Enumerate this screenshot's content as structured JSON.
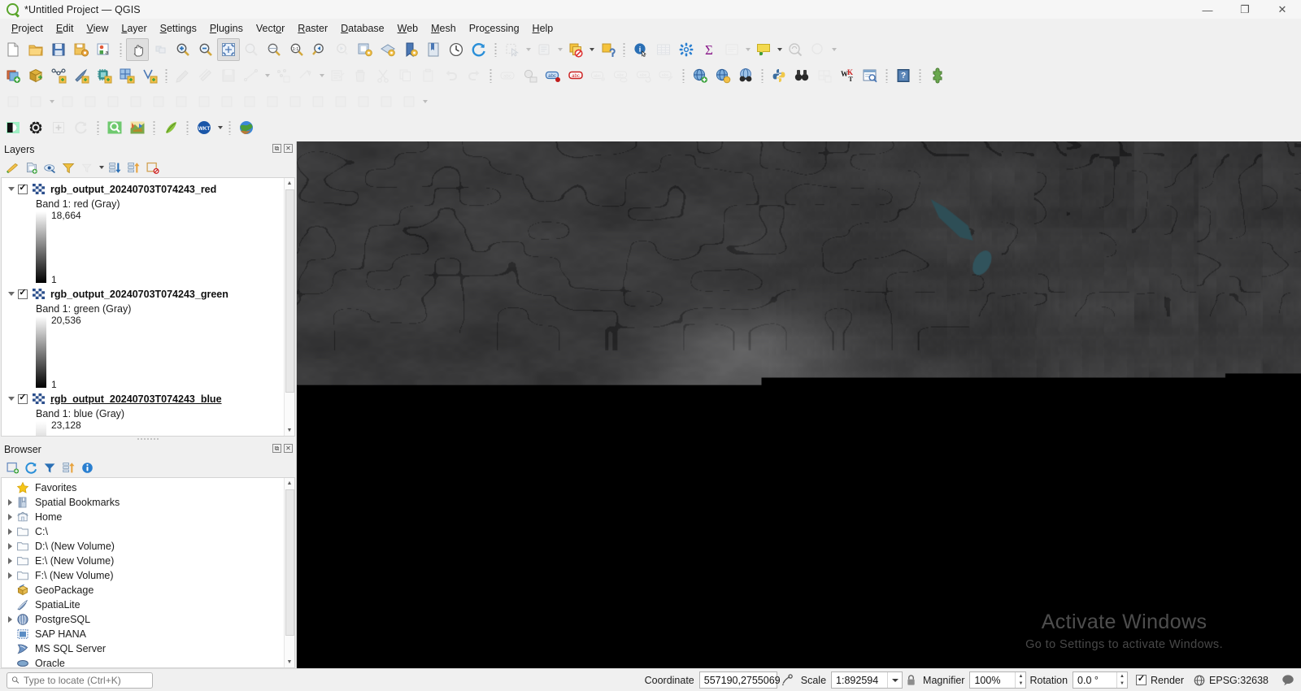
{
  "window": {
    "title": "*Untitled Project — QGIS",
    "logo_icon": "qgis-logo-icon",
    "minimize_label": "—",
    "maximize_label": "❐",
    "close_label": "✕"
  },
  "menubar": {
    "items": [
      {
        "label": "Project",
        "accel": "P"
      },
      {
        "label": "Edit",
        "accel": "E"
      },
      {
        "label": "View",
        "accel": "V"
      },
      {
        "label": "Layer",
        "accel": "L"
      },
      {
        "label": "Settings",
        "accel": "S"
      },
      {
        "label": "Plugins",
        "accel": "P"
      },
      {
        "label": "Vector",
        "accel": "o"
      },
      {
        "label": "Raster",
        "accel": "R"
      },
      {
        "label": "Database",
        "accel": "D"
      },
      {
        "label": "Web",
        "accel": "W"
      },
      {
        "label": "Mesh",
        "accel": "M"
      },
      {
        "label": "Processing",
        "accel": "c"
      },
      {
        "label": "Help",
        "accel": "H"
      }
    ]
  },
  "toolbars": {
    "row1": [
      {
        "icon": "new-project-icon",
        "state": "normal"
      },
      {
        "icon": "open-project-icon",
        "state": "normal"
      },
      {
        "icon": "save-project-icon",
        "state": "normal"
      },
      {
        "icon": "save-project-as-icon",
        "state": "normal"
      },
      {
        "icon": "new-print-layout-icon",
        "state": "normal"
      },
      {
        "sep": true
      },
      {
        "icon": "pan-map-icon",
        "state": "active"
      },
      {
        "icon": "pan-to-selection-icon",
        "state": "disabled"
      },
      {
        "icon": "zoom-in-icon",
        "state": "normal"
      },
      {
        "icon": "zoom-out-icon",
        "state": "normal"
      },
      {
        "icon": "zoom-full-icon",
        "state": "active"
      },
      {
        "icon": "zoom-to-selection-icon",
        "state": "disabled"
      },
      {
        "icon": "zoom-to-layer-icon",
        "state": "normal"
      },
      {
        "icon": "zoom-native-resolution-icon",
        "state": "normal"
      },
      {
        "icon": "zoom-last-icon",
        "state": "normal"
      },
      {
        "icon": "zoom-next-icon",
        "state": "disabled"
      },
      {
        "icon": "new-map-view-icon",
        "state": "normal"
      },
      {
        "icon": "new-3d-map-view-icon",
        "state": "normal"
      },
      {
        "icon": "show-bookmarks-icon",
        "state": "normal"
      },
      {
        "icon": "new-bookmark-icon",
        "state": "normal"
      },
      {
        "icon": "temporal-controller-icon",
        "state": "normal"
      },
      {
        "icon": "refresh-icon",
        "state": "normal"
      },
      {
        "sep": true
      },
      {
        "icon": "select-features-icon",
        "state": "disabled"
      },
      {
        "caret": true,
        "state": "disabled"
      },
      {
        "icon": "select-by-form-icon",
        "state": "disabled"
      },
      {
        "caret": true,
        "state": "disabled"
      },
      {
        "icon": "deselect-features-icon",
        "state": "normal"
      },
      {
        "caret": true
      },
      {
        "icon": "identify-features-icon",
        "state": "normal"
      },
      {
        "sep": true
      },
      {
        "icon": "info-tool-icon",
        "state": "normal"
      },
      {
        "icon": "open-attribute-table-icon",
        "state": "disabled"
      },
      {
        "icon": "processing-toolbox-icon",
        "state": "normal"
      },
      {
        "icon": "statistical-summary-icon",
        "state": "normal"
      },
      {
        "icon": "measure-line-icon",
        "state": "disabled"
      },
      {
        "caret": true,
        "state": "disabled"
      },
      {
        "icon": "map-tips-icon",
        "state": "normal"
      },
      {
        "caret": true
      },
      {
        "icon": "annotation-icon",
        "state": "normal"
      },
      {
        "icon": "search-layer-icon",
        "state": "disabled"
      },
      {
        "caret": true,
        "state": "disabled"
      }
    ],
    "row2": [
      {
        "icon": "current-edits-icon",
        "state": "normal"
      },
      {
        "icon": "new-geopackage-layer-icon",
        "state": "normal"
      },
      {
        "icon": "new-shapefile-layer-icon",
        "state": "normal"
      },
      {
        "icon": "new-spatialite-layer-icon",
        "state": "normal"
      },
      {
        "icon": "new-memory-layer-icon",
        "state": "normal"
      },
      {
        "icon": "new-mesh-layer-icon",
        "state": "normal"
      },
      {
        "icon": "new-gpx-layer-icon",
        "state": "normal"
      },
      {
        "sep": true
      },
      {
        "icon": "toggle-editing-icon",
        "state": "disabled"
      },
      {
        "icon": "multi-edit-icon",
        "state": "disabled"
      },
      {
        "icon": "save-layer-edits-icon",
        "state": "disabled"
      },
      {
        "icon": "add-line-feature-icon",
        "state": "disabled"
      },
      {
        "caret": true,
        "state": "disabled"
      },
      {
        "icon": "vertex-tool-icon",
        "state": "disabled"
      },
      {
        "icon": "modify-attributes-icon",
        "state": "disabled"
      },
      {
        "caret": true,
        "state": "disabled"
      },
      {
        "icon": "edit-attributes-icon",
        "state": "disabled"
      },
      {
        "icon": "delete-selected-icon",
        "state": "disabled"
      },
      {
        "icon": "cut-features-icon",
        "state": "disabled"
      },
      {
        "icon": "copy-features-icon",
        "state": "disabled"
      },
      {
        "icon": "paste-features-icon",
        "state": "disabled"
      },
      {
        "icon": "undo-icon",
        "state": "disabled"
      },
      {
        "icon": "redo-icon",
        "state": "disabled"
      },
      {
        "sep": true
      },
      {
        "icon": "label-disabled-icon",
        "state": "disabled"
      },
      {
        "icon": "highlight-labels-icon",
        "state": "normal"
      },
      {
        "icon": "pin-labels-icon",
        "state": "normal"
      },
      {
        "icon": "unpin-labels-icon",
        "state": "normal"
      },
      {
        "icon": "move-label-icon",
        "state": "disabled"
      },
      {
        "icon": "show-hide-labels-icon",
        "state": "disabled"
      },
      {
        "icon": "rotate-label-icon",
        "state": "disabled"
      },
      {
        "icon": "change-label-icon",
        "state": "disabled"
      },
      {
        "sep": true
      },
      {
        "icon": "add-wms-layer-icon",
        "state": "normal"
      },
      {
        "icon": "add-wfs-layer-icon",
        "state": "normal"
      },
      {
        "icon": "metasearch-icon",
        "state": "normal"
      },
      {
        "sep": true
      },
      {
        "icon": "python-console-icon",
        "state": "normal"
      },
      {
        "icon": "qgis-binoculars-icon",
        "state": "normal"
      },
      {
        "icon": "georeferencer-icon",
        "state": "disabled"
      },
      {
        "icon": "wkt-tools-icon",
        "state": "normal"
      },
      {
        "icon": "layer-inspector-icon",
        "state": "normal"
      },
      {
        "sep": true
      },
      {
        "icon": "help-contents-icon",
        "state": "normal"
      },
      {
        "sep": true
      },
      {
        "icon": "plugin-manager-icon",
        "state": "normal"
      }
    ],
    "row3": [
      {
        "icon": "advanced-digitizing-icon",
        "state": "faded"
      },
      {
        "icon": "enable-tracing-icon",
        "state": "faded"
      },
      {
        "caret": true,
        "state": "faded"
      },
      {
        "icon": "rotate-feature-icon",
        "state": "faded"
      },
      {
        "icon": "simplify-feature-icon",
        "state": "faded"
      },
      {
        "icon": "add-ring-icon",
        "state": "faded"
      },
      {
        "icon": "add-part-icon",
        "state": "faded"
      },
      {
        "icon": "fill-ring-icon",
        "state": "faded"
      },
      {
        "icon": "delete-ring-icon",
        "state": "faded"
      },
      {
        "icon": "delete-part-icon",
        "state": "faded"
      },
      {
        "icon": "reshape-features-icon",
        "state": "faded"
      },
      {
        "icon": "offset-curve-icon",
        "state": "faded"
      },
      {
        "icon": "reverse-line-icon",
        "state": "faded"
      },
      {
        "icon": "split-features-icon",
        "state": "faded"
      },
      {
        "icon": "split-parts-icon",
        "state": "faded"
      },
      {
        "icon": "merge-features-icon",
        "state": "faded"
      },
      {
        "icon": "merge-attributes-icon",
        "state": "faded"
      },
      {
        "icon": "rotate-point-symbols-icon",
        "state": "faded"
      },
      {
        "icon": "offset-point-symbol-icon",
        "state": "faded"
      },
      {
        "caret": true,
        "state": "faded"
      }
    ],
    "row4": [
      {
        "icon": "raster-contrast-icon",
        "state": "normal"
      },
      {
        "icon": "settings-gear-icon",
        "state": "normal"
      },
      {
        "icon": "plus-box-icon",
        "state": "disabled"
      },
      {
        "icon": "reload-circle-icon",
        "state": "disabled"
      },
      {
        "sep": true
      },
      {
        "icon": "magnifier-green-icon",
        "state": "normal"
      },
      {
        "icon": "colorful-map-icon",
        "state": "normal"
      },
      {
        "sep": true
      },
      {
        "icon": "leaf-green-icon",
        "state": "normal"
      },
      {
        "sep": true
      },
      {
        "icon": "wkt-circle-icon",
        "state": "normal"
      },
      {
        "caret": true
      },
      {
        "sep": true
      },
      {
        "icon": "globe-earth-icon",
        "state": "normal"
      }
    ]
  },
  "layers_panel": {
    "title": "Layers",
    "header_buttons": [
      {
        "icon": "float-panel-icon",
        "label": "⧉"
      },
      {
        "icon": "close-panel-icon",
        "label": "✕"
      }
    ],
    "tools": [
      {
        "icon": "open-layer-styling-icon",
        "state": "normal"
      },
      {
        "icon": "add-group-icon",
        "state": "normal"
      },
      {
        "icon": "manage-map-themes-icon",
        "state": "normal"
      },
      {
        "icon": "filter-legend-icon",
        "state": "normal"
      },
      {
        "icon": "filter-legend-expression-icon",
        "state": "disabled"
      },
      {
        "caret": true
      },
      {
        "icon": "expand-all-icon",
        "state": "normal"
      },
      {
        "icon": "collapse-all-icon",
        "state": "normal"
      },
      {
        "icon": "remove-layer-icon",
        "state": "normal"
      }
    ],
    "layers": [
      {
        "name": "rgb_output_20240703T074243_red",
        "checked": true,
        "expanded": true,
        "hovered": false,
        "band": "Band 1: red (Gray)",
        "ramp_max": "18,664",
        "ramp_min": "1",
        "ramp_style": "full"
      },
      {
        "name": "rgb_output_20240703T074243_green",
        "checked": true,
        "expanded": true,
        "hovered": false,
        "band": "Band 1: green (Gray)",
        "ramp_max": "20,536",
        "ramp_min": "1",
        "ramp_style": "full"
      },
      {
        "name": "rgb_output_20240703T074243_blue",
        "checked": true,
        "expanded": true,
        "hovered": true,
        "band": "Band 1: blue (Gray)",
        "ramp_max": "23,128",
        "ramp_min": "",
        "ramp_style": "part"
      }
    ]
  },
  "browser_panel": {
    "title": "Browser",
    "header_buttons": [
      {
        "icon": "float-panel-icon",
        "label": "⧉"
      },
      {
        "icon": "close-panel-icon",
        "label": "✕"
      }
    ],
    "tools": [
      {
        "icon": "add-layer-icon",
        "state": "normal"
      },
      {
        "icon": "refresh-icon",
        "state": "normal"
      },
      {
        "icon": "filter-browser-icon",
        "state": "normal"
      },
      {
        "icon": "collapse-all-icon",
        "state": "normal"
      },
      {
        "icon": "enable-properties-widget-icon",
        "state": "normal"
      }
    ],
    "items": [
      {
        "label": "Favorites",
        "icon": "star-icon",
        "expandable": false
      },
      {
        "label": "Spatial Bookmarks",
        "icon": "bookmark-icon",
        "expandable": true
      },
      {
        "label": "Home",
        "icon": "home-icon",
        "expandable": true
      },
      {
        "label": "C:\\",
        "icon": "folder-icon",
        "expandable": true
      },
      {
        "label": "D:\\ (New Volume)",
        "icon": "folder-icon",
        "expandable": true
      },
      {
        "label": "E:\\ (New Volume)",
        "icon": "folder-icon",
        "expandable": true
      },
      {
        "label": "F:\\ (New Volume)",
        "icon": "folder-icon",
        "expandable": true
      },
      {
        "label": "GeoPackage",
        "icon": "geopackage-icon",
        "expandable": false
      },
      {
        "label": "SpatiaLite",
        "icon": "spatialite-icon",
        "expandable": false
      },
      {
        "label": "PostgreSQL",
        "icon": "postgresql-icon",
        "expandable": true
      },
      {
        "label": "SAP HANA",
        "icon": "sap-hana-icon",
        "expandable": false
      },
      {
        "label": "MS SQL Server",
        "icon": "mssql-icon",
        "expandable": false
      },
      {
        "label": "Oracle",
        "icon": "oracle-icon",
        "expandable": false
      }
    ]
  },
  "map": {
    "watermark_line1": "Activate Windows",
    "watermark_line2": "Go to Settings to activate Windows.",
    "background_colors": {
      "desert_light": "#e8c5af",
      "desert_pale": "#f0dcc8",
      "dune_orange": "#f08a6a",
      "raster_dark": "#3a3a3a",
      "water_teal": "#2d4a52"
    }
  },
  "statusbar": {
    "locate_placeholder": "Type to locate (Ctrl+K)",
    "locate_value": "",
    "locate_icon": "search-icon",
    "coordinate_label": "Coordinate",
    "coordinate_value": "557190,2755069",
    "coordinate_toggle_icon": "toggle-extents-icon",
    "scale_label": "Scale",
    "scale_value": "1:892594",
    "lock_icon": "lock-scale-icon",
    "magnifier_label": "Magnifier",
    "magnifier_value": "100%",
    "rotation_label": "Rotation",
    "rotation_value": "0.0 °",
    "render_label": "Render",
    "render_checked": true,
    "crs_label": "EPSG:32638",
    "crs_icon": "globe-icon",
    "messages_icon": "messages-icon"
  }
}
